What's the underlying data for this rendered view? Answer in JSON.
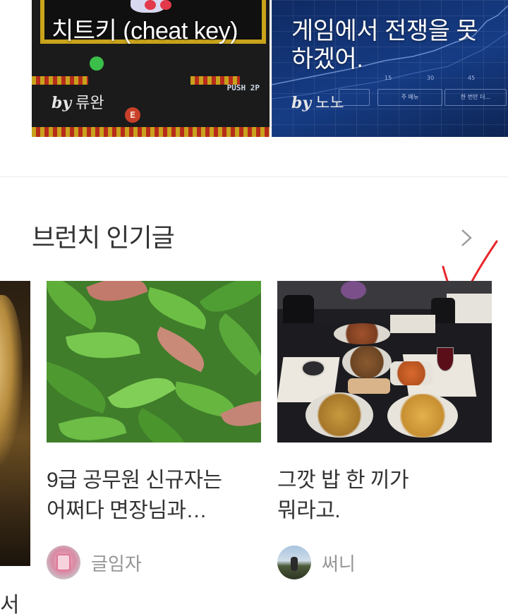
{
  "top_cards": [
    {
      "title": "치트키 (cheat key)",
      "by_label": "by",
      "author": "류완"
    },
    {
      "title": "게임에서 전쟁을 못하겠어.",
      "by_label": "by",
      "author": "노노"
    }
  ],
  "game_art": {
    "push_label": "PUSH 2P",
    "badge": "E"
  },
  "chart_art": {
    "ticks": [
      "15",
      "30",
      "45"
    ],
    "tabs": [
      "",
      "주 메뉴",
      "한 번만 더..."
    ]
  },
  "section": {
    "title": "브런치 인기글",
    "more_icon": "chevron-right-icon"
  },
  "peek_text": "서",
  "posts": [
    {
      "title_line1": "9급 공무원 신규자는",
      "title_line2": "어쩌다 면장님과…",
      "author": "글임자",
      "image": "green-leaves-photo"
    },
    {
      "title_line1": "그깟 밥 한 끼가",
      "title_line2": "뭐라고.",
      "author": "써니",
      "image": "dinner-table-photo"
    }
  ],
  "colors": {
    "text": "#333333",
    "author": "#959595",
    "divider": "#ececec",
    "annotation": "#e8262a"
  }
}
